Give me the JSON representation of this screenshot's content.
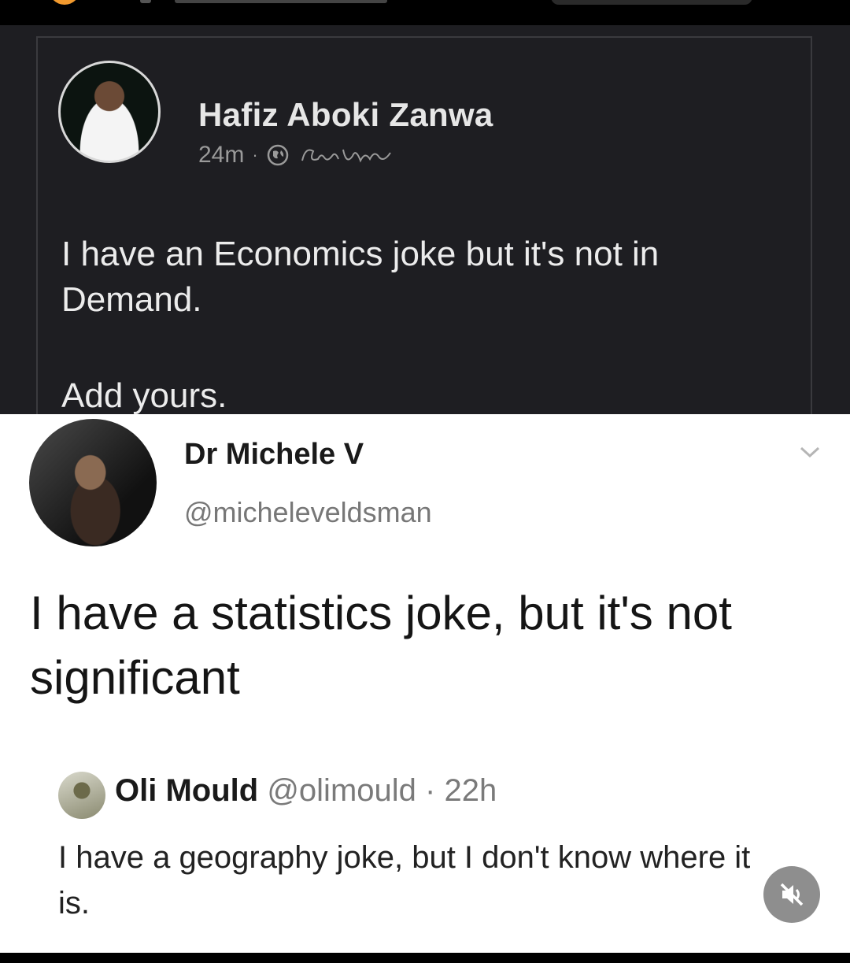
{
  "fb_post": {
    "author": "Hafiz Aboki Zanwa",
    "time": "24m",
    "separator": "·",
    "signature": "Cards Talk",
    "text": "I have an Economics joke but it's not in Demand.",
    "text2": "Add yours."
  },
  "tweet": {
    "name": "Dr Michele V",
    "handle": "@micheleveldsman",
    "text": "I have a statistics joke, but it's not significant",
    "reply": {
      "name": "Oli Mould",
      "handle": "@olimould",
      "separator": "·",
      "time": "22h",
      "text": "I have a geography joke, but I don't know where it is."
    }
  },
  "icons": {
    "audience": "globe-icon",
    "more": "chevron-down-icon",
    "mute": "speaker-muted-icon"
  }
}
